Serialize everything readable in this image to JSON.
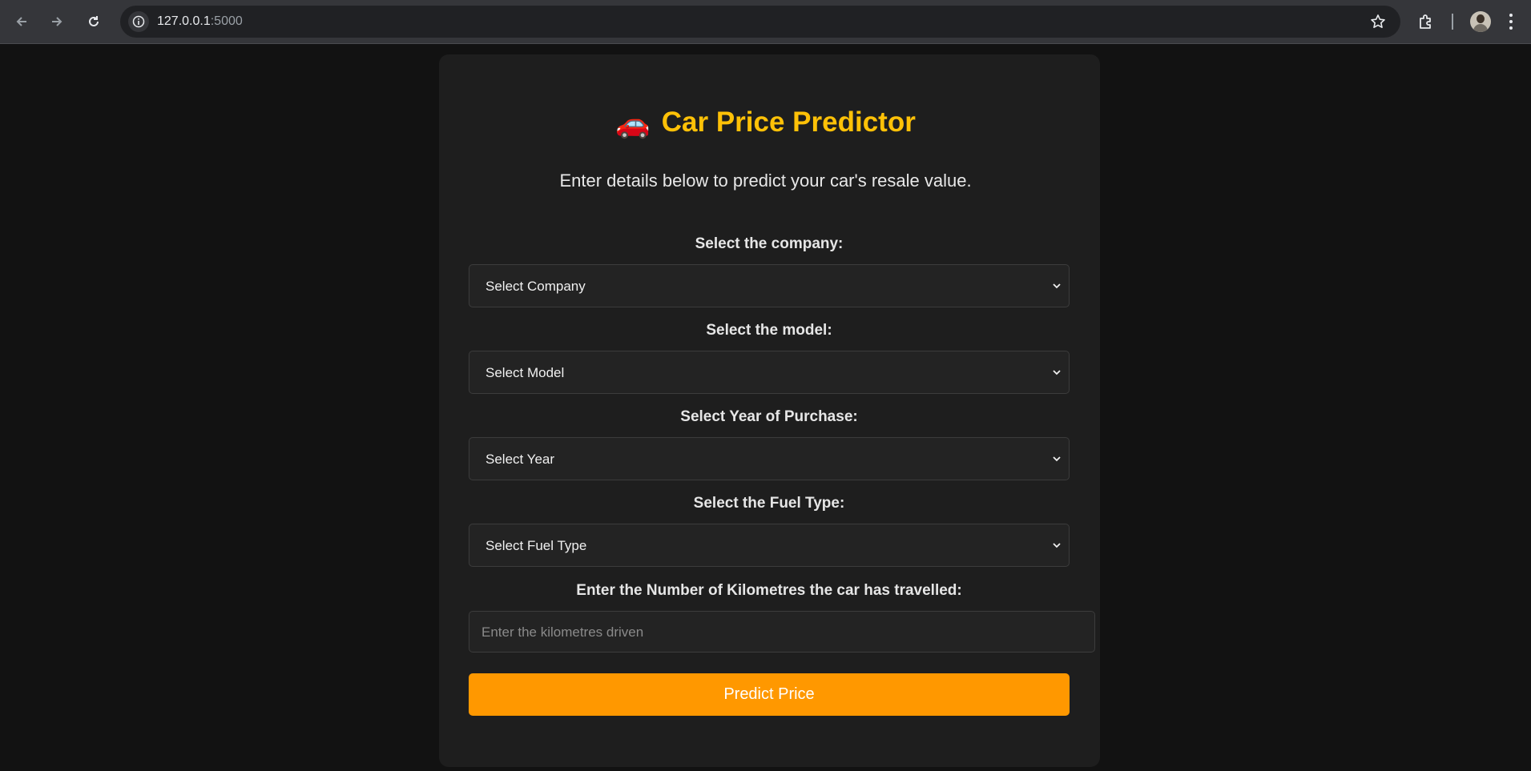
{
  "browser": {
    "url_host": "127.0.0.1",
    "url_port": ":5000"
  },
  "page": {
    "title_icon": "🚗",
    "title": "Car Price Predictor",
    "subtitle": "Enter details below to predict your car's resale value."
  },
  "form": {
    "company": {
      "label": "Select the company:",
      "value": "Select Company"
    },
    "model": {
      "label": "Select the model:",
      "value": "Select Model"
    },
    "year": {
      "label": "Select Year of Purchase:",
      "value": "Select Year"
    },
    "fuel": {
      "label": "Select the Fuel Type:",
      "value": "Select Fuel Type"
    },
    "kilometres": {
      "label": "Enter the Number of Kilometres the car has travelled:",
      "placeholder": "Enter the kilometres driven"
    },
    "submit_label": "Predict Price"
  },
  "colors": {
    "accent": "#ffc107",
    "button": "#ff9800",
    "background": "#121212",
    "card": "#1e1e1e"
  }
}
